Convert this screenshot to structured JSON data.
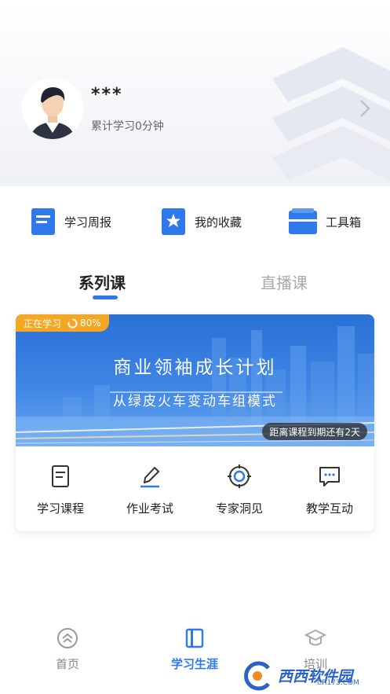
{
  "profile": {
    "name": "***",
    "study_time": "累计学习0分钟"
  },
  "quick_actions": [
    {
      "label": "学习周报",
      "icon": "report-icon"
    },
    {
      "label": "我的收藏",
      "icon": "favorites-icon"
    },
    {
      "label": "工具箱",
      "icon": "toolbox-icon"
    }
  ],
  "tabs": {
    "series": "系列课",
    "live": "直播课"
  },
  "course_card": {
    "badge_label": "正在学习",
    "progress": "80%",
    "title": "商业领袖成长计划",
    "subtitle": "从绿皮火车变动车组模式",
    "due": "距离课程到期还有2天",
    "features": [
      {
        "label": "学习课程",
        "icon": "document-icon"
      },
      {
        "label": "作业考试",
        "icon": "pen-icon"
      },
      {
        "label": "专家洞见",
        "icon": "target-icon"
      },
      {
        "label": "教学互动",
        "icon": "chat-icon"
      }
    ]
  },
  "bottom_nav": [
    {
      "label": "首页",
      "icon": "home-icon"
    },
    {
      "label": "学习生涯",
      "icon": "book-icon"
    },
    {
      "label": "培训",
      "icon": "graduation-cap-icon"
    }
  ],
  "watermark": {
    "text": "西西软件园",
    "sub": "CR173.COM"
  },
  "colors": {
    "accent": "#2f79ea",
    "badge": "#f5a623",
    "banner": "#2a70d6"
  }
}
